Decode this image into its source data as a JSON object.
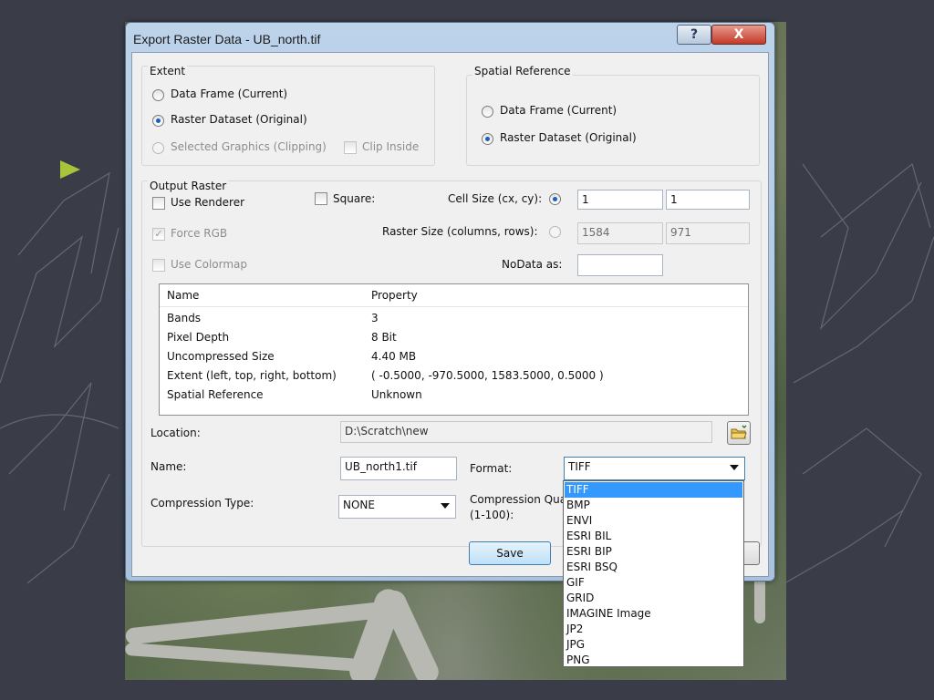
{
  "dialog": {
    "title": "Export Raster Data - UB_north.tif",
    "help_label": "?",
    "close_label": "X"
  },
  "extent": {
    "label": "Extent",
    "data_frame": "Data Frame (Current)",
    "raster_dataset": "Raster Dataset (Original)",
    "selected_graphics": "Selected Graphics (Clipping)",
    "clip_inside": "Clip Inside",
    "selected": "raster_dataset"
  },
  "spatial_reference": {
    "label": "Spatial Reference",
    "data_frame": "Data Frame (Current)",
    "raster_dataset": "Raster Dataset (Original)",
    "selected": "raster_dataset"
  },
  "output_raster": {
    "label": "Output Raster",
    "use_renderer": "Use Renderer",
    "square": "Square:",
    "cell_size_label": "Cell Size (cx, cy):",
    "cell_size_x": "1",
    "cell_size_y": "1",
    "force_rgb": "Force RGB",
    "raster_size_label": "Raster Size (columns, rows):",
    "raster_columns": "1584",
    "raster_rows": "971",
    "use_colormap": "Use Colormap",
    "nodata_label": "NoData as:",
    "nodata_value": ""
  },
  "properties": {
    "headers": [
      "Name",
      "Property"
    ],
    "rows": [
      [
        "Bands",
        "3"
      ],
      [
        "Pixel Depth",
        "8 Bit"
      ],
      [
        "Uncompressed Size",
        "4.40 MB"
      ],
      [
        "Extent (left, top, right, bottom)",
        "( -0.5000, -970.5000, 1583.5000, 0.5000 )"
      ],
      [
        "Spatial Reference",
        "Unknown"
      ]
    ]
  },
  "location": {
    "label": "Location:",
    "value": "D:\\Scratch\\new"
  },
  "name": {
    "label": "Name:",
    "value": "UB_north1.tif"
  },
  "format": {
    "label": "Format:",
    "value": "TIFF",
    "options": [
      "TIFF",
      "BMP",
      "ENVI",
      "ESRI BIL",
      "ESRI BIP",
      "ESRI BSQ",
      "GIF",
      "GRID",
      "IMAGINE Image",
      "JP2",
      "JPG",
      "PNG"
    ]
  },
  "compression": {
    "type_label": "Compression Type:",
    "type_value": "NONE",
    "quality_label_1": "Compression Qua",
    "quality_label_2": "(1-100):"
  },
  "buttons": {
    "save": "Save"
  },
  "colors": {
    "bullet": "#a8c43a",
    "selection": "#3399ff",
    "slide_background": "#3a3d48"
  }
}
